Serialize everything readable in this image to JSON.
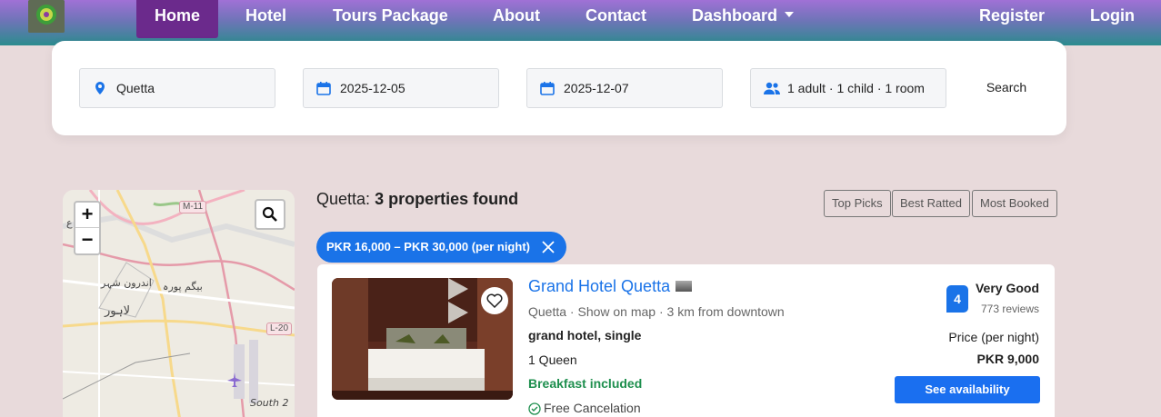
{
  "nav": {
    "home": "Home",
    "hotel": "Hotel",
    "tours": "Tours Package",
    "about": "About",
    "contact": "Contact",
    "dashboard": "Dashboard",
    "register": "Register",
    "login": "Login",
    "logo_icon": "site-logo"
  },
  "search": {
    "location": "Quetta",
    "check_in": "2025-12-05",
    "check_out": "2025-12-07",
    "guests": "1 adult · 1 child · 1 room",
    "button": "Search"
  },
  "map": {
    "zoom_in": "+",
    "zoom_out": "−",
    "labels": {
      "road_m11": "M-11",
      "road_l20": "L-20",
      "city_begum": "بیگم پورہ",
      "city_andron": "اندرون شہر",
      "city_lahore": "لاہور",
      "area_south": "South 2",
      "edge_text": "ع"
    }
  },
  "results": {
    "city_prefix": "Quetta:",
    "count_text": "3 properties found",
    "sort": [
      "Top Picks",
      "Best Ratted",
      "Most Booked"
    ],
    "filter_chip": "PKR 16,000 – PKR 30,000 (per night)"
  },
  "hotel": {
    "name": "Grand Hotel Quetta",
    "location": "Quetta",
    "map_link": "Show on map",
    "distance": "3 km from downtown",
    "room": "grand hotel, single",
    "bed": "1 Queen",
    "breakfast": "Breakfast included",
    "cancel": "Free Cancelation",
    "score": "4",
    "rating_word": "Very Good",
    "reviews": "773 reviews",
    "price_label": "Price (per night)",
    "price": "PKR 9,000",
    "cta": "See availability"
  },
  "colors": {
    "accent": "#1a73e8",
    "nav_active": "#6b2a8c",
    "breakfast": "#1e8f4e",
    "page_bg": "#e8dadb"
  }
}
